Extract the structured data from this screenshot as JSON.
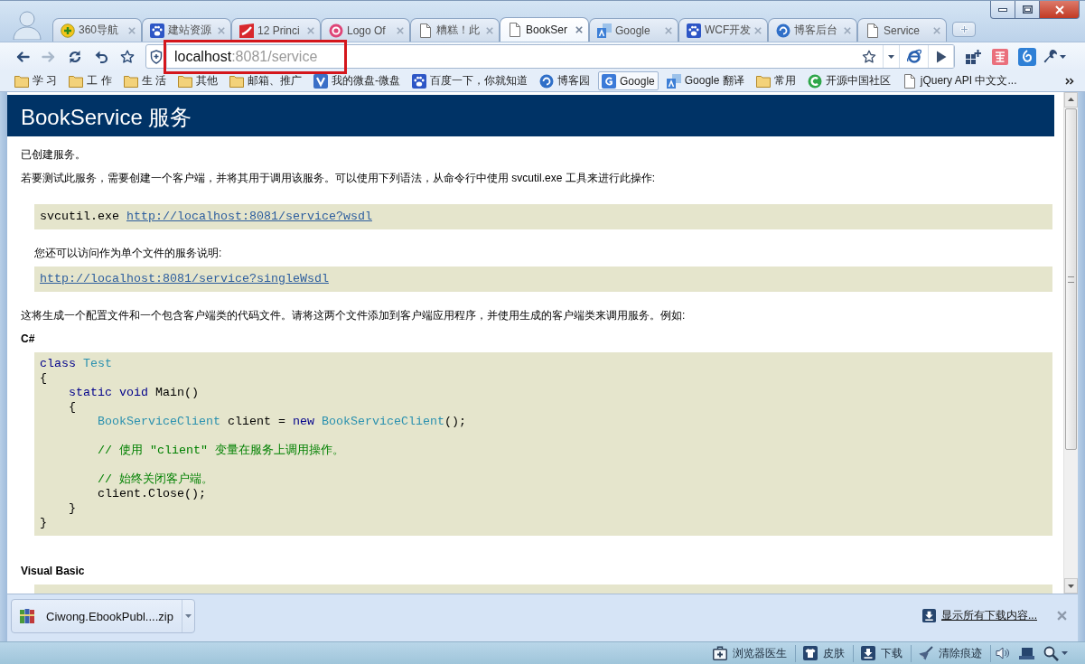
{
  "tabs": [
    {
      "label": "360导航",
      "kind": "plus",
      "selected": false
    },
    {
      "label": "建站资源",
      "kind": "paw",
      "selected": false
    },
    {
      "label": "12 Princi",
      "kind": "swoosh",
      "selected": false
    },
    {
      "label": "Logo Of",
      "kind": "ring",
      "selected": false
    },
    {
      "label": "糟糕！此",
      "kind": "page",
      "selected": false
    },
    {
      "label": "BookSer",
      "kind": "page",
      "selected": true
    },
    {
      "label": "Google",
      "kind": "translate",
      "selected": false
    },
    {
      "label": "WCF开发",
      "kind": "paw",
      "selected": false
    },
    {
      "label": "博客后台",
      "kind": "globe",
      "selected": false
    },
    {
      "label": "Service",
      "kind": "page",
      "selected": false
    }
  ],
  "toolbar": {
    "buttons": [
      {
        "kind": "back",
        "disabled": false
      },
      {
        "kind": "forward",
        "disabled": true
      },
      {
        "kind": "reload",
        "disabled": false
      },
      {
        "kind": "undo",
        "disabled": false
      },
      {
        "kind": "star",
        "disabled": false
      }
    ]
  },
  "address_bar": {
    "host": "localhost",
    "path": ":8081/service",
    "highlighted": true
  },
  "bookmarks": [
    {
      "label": "学 习",
      "kind": "folder",
      "hovered": false
    },
    {
      "label": "工 作",
      "kind": "folder",
      "hovered": false
    },
    {
      "label": "生 活",
      "kind": "folder",
      "hovered": false
    },
    {
      "label": "其他",
      "kind": "folder",
      "hovered": false
    },
    {
      "label": "邮箱、推广",
      "kind": "folder",
      "hovered": false
    },
    {
      "label": "我的微盘-微盘",
      "kind": "chevron",
      "hovered": false
    },
    {
      "label": "百度一下，你就知道",
      "kind": "paw",
      "hovered": false
    },
    {
      "label": "博客园",
      "kind": "globe",
      "hovered": false
    },
    {
      "label": "Google",
      "kind": "arc",
      "hovered": true
    },
    {
      "label": "Google 翻译",
      "kind": "translate",
      "hovered": false
    },
    {
      "label": "常用",
      "kind": "folder",
      "hovered": false
    },
    {
      "label": "开源中国社区",
      "kind": "crescent",
      "hovered": false
    },
    {
      "label": "jQuery API 中文文...",
      "kind": "page",
      "hovered": false
    }
  ],
  "page": {
    "title": "BookService 服务",
    "created": "已创建服务。",
    "intro": "若要测试此服务，需要创建一个客户端，并将其用于调用该服务。可以使用下列语法，从命令行中使用 svcutil.exe 工具来进行此操作:",
    "command": "svcutil.exe",
    "wsdl_link": "http://localhost:8081/service?wsdl",
    "single_file_note": "您还可以访问作为单个文件的服务说明:",
    "single_wsdl_link": "http://localhost:8081/service?singleWsdl",
    "generate_note": "这将生成一个配置文件和一个包含客户端类的代码文件。请将这两个文件添加到客户端应用程序，并使用生成的客户端类来调用服务。例如:",
    "sections": [
      {
        "heading": "C#",
        "code": [
          {
            "kind": "code",
            "tokens": [
              {
                "kind": "keyword",
                "text": "class "
              },
              {
                "kind": "type",
                "text": "Test"
              }
            ]
          },
          {
            "kind": "code",
            "tokens": [
              {
                "kind": "plain",
                "text": "{"
              }
            ]
          },
          {
            "kind": "block",
            "children": [
              {
                "kind": "code",
                "tokens": [
                  {
                    "kind": "keyword",
                    "text": "static void "
                  },
                  {
                    "kind": "plain",
                    "text": "Main()"
                  }
                ]
              },
              {
                "kind": "code",
                "tokens": [
                  {
                    "kind": "plain",
                    "text": "{"
                  }
                ]
              },
              {
                "kind": "block",
                "children": [
                  {
                    "kind": "code",
                    "tokens": [
                      {
                        "kind": "type",
                        "text": "BookServiceClient"
                      },
                      {
                        "kind": "plain",
                        "text": " client = "
                      },
                      {
                        "kind": "keyword",
                        "text": "new "
                      },
                      {
                        "kind": "type",
                        "text": "BookServiceClient"
                      },
                      {
                        "kind": "plain",
                        "text": "();"
                      }
                    ]
                  },
                  {
                    "kind": "blank"
                  },
                  {
                    "kind": "code",
                    "tokens": [
                      {
                        "kind": "comment",
                        "text": "// 使用 \"client\" 变量在服务上调用操作。"
                      }
                    ]
                  },
                  {
                    "kind": "blank"
                  },
                  {
                    "kind": "code",
                    "tokens": [
                      {
                        "kind": "comment",
                        "text": "// 始终关闭客户端。"
                      }
                    ]
                  },
                  {
                    "kind": "code",
                    "tokens": [
                      {
                        "kind": "plain",
                        "text": "client.Close();"
                      }
                    ]
                  }
                ]
              },
              {
                "kind": "code",
                "tokens": [
                  {
                    "kind": "plain",
                    "text": "}"
                  }
                ]
              }
            ]
          },
          {
            "kind": "code",
            "tokens": [
              {
                "kind": "plain",
                "text": "}"
              }
            ]
          }
        ]
      },
      {
        "heading": "Visual Basic"
      }
    ]
  },
  "download_bar": {
    "downloads": [
      {
        "file": "Ciwong.EbookPubl....zip"
      }
    ],
    "show_all": "显示所有下载内容..."
  },
  "status_bar": {
    "items": [
      {
        "label": "浏览器医生",
        "kind": "doctor"
      },
      {
        "label": "皮肤",
        "kind": "skin"
      },
      {
        "label": "下载",
        "kind": "download"
      },
      {
        "label": "清除痕迹",
        "kind": "clean"
      }
    ]
  }
}
